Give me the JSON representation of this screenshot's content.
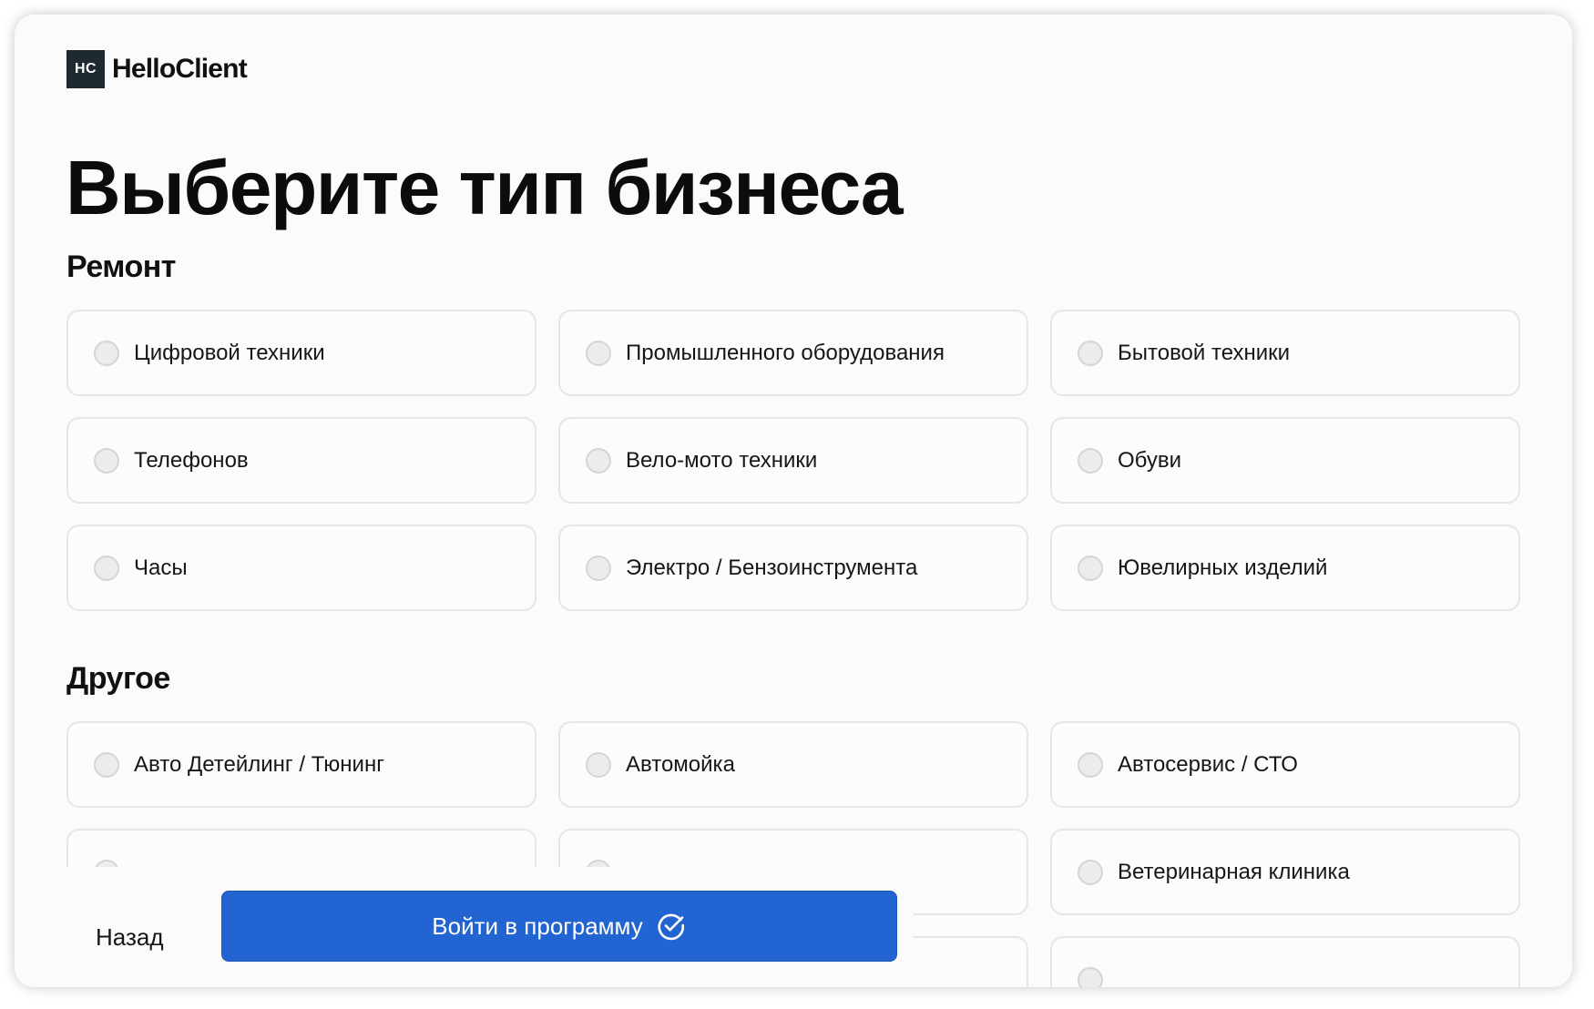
{
  "brand": {
    "mark": "HC",
    "name": "HelloClient"
  },
  "page_title": "Выберите тип бизнеса",
  "sections": [
    {
      "title": "Ремонт",
      "options": [
        "Цифровой техники",
        "Промышленного оборудования",
        "Бытовой техники",
        "Телефонов",
        "Вело-мото техники",
        "Обуви",
        "Часы",
        "Электро / Бензоинструмента",
        "Ювелирных изделий"
      ]
    },
    {
      "title": "Другое",
      "options": [
        "Авто Детейлинг / Тюнинг",
        "Автомойка",
        "Автосервис / СТО",
        "",
        "",
        "Ветеринарная клиника",
        "",
        "",
        ""
      ]
    }
  ],
  "footer": {
    "back_label": "Назад",
    "enter_label": "Войти в программу",
    "enter_icon": "check-circle-icon"
  },
  "colors": {
    "primary": "#2264d1",
    "brand_mark_bg": "#1f2a30",
    "card_border": "#e6e6e6"
  }
}
